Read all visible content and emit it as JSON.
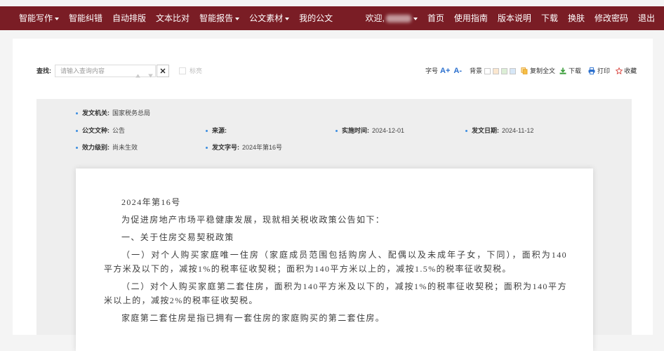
{
  "colors": {
    "nav_background": "#7a1d25",
    "accent_blue": "#2a6fce",
    "bullet_blue": "#3d8ee0",
    "meta_background": "#eeeeee"
  },
  "nav": {
    "left_items": [
      {
        "label": "智能写作",
        "icon": "chevron-down-icon"
      },
      {
        "label": "智能纠错"
      },
      {
        "label": "自动排版"
      },
      {
        "label": "文本比对"
      },
      {
        "label": "智能报告",
        "icon": "chevron-down-icon"
      },
      {
        "label": "公文素材",
        "icon": "chevron-down-icon"
      },
      {
        "label": "我的公文"
      }
    ],
    "user_menu": {
      "welcome": "欢迎,",
      "icon": "chevron-down-icon"
    },
    "right_items": [
      "首页",
      "使用指南",
      "版本说明",
      "下载",
      "换肤",
      "修改密码",
      "退出"
    ]
  },
  "search": {
    "label": "查找:",
    "placeholder": "请输入查询内容",
    "value": "",
    "prev_icon": "arrow-up-icon",
    "next_icon": "arrow-down-icon",
    "clear_icon": "close-icon",
    "highlight_label": "标亮",
    "highlight_checked": false
  },
  "toolbar": {
    "font_size_label": "字号",
    "font_increase": "A+",
    "font_decrease": "A-",
    "background_label": "背景",
    "background_swatches": [
      "#ffffff",
      "#fbe7cf",
      "#dcefd6",
      "#d6e7f7"
    ],
    "copy": {
      "label": "复制全文",
      "icon": "copy-icon"
    },
    "download": {
      "label": "下载",
      "icon": "download-icon"
    },
    "print": {
      "label": "打印",
      "icon": "print-icon"
    },
    "favorite": {
      "label": "收藏",
      "icon": "star-icon"
    }
  },
  "meta": {
    "rows": [
      [
        {
          "label": "发文机关:",
          "value": "国家税务总局"
        }
      ],
      [
        {
          "label": "公文文种:",
          "value": "公告"
        },
        {
          "label": "来源:",
          "value": ""
        },
        {
          "label": "实施时间:",
          "value": "2024-12-01"
        },
        {
          "label": "发文日期:",
          "value": "2024-11-12"
        }
      ],
      [
        {
          "label": "效力级别:",
          "value": "尚未生效"
        },
        {
          "label": "发文字号:",
          "value": "2024年第16号"
        }
      ]
    ]
  },
  "document": {
    "paragraphs": [
      {
        "lines": [
          "2024年第16号"
        ]
      },
      {
        "lines": [
          "为促进房地产市场平稳健康发展，现就相关税收政策公告如下："
        ]
      },
      {
        "lines": [
          "一、关于住房交易契税政策"
        ]
      },
      {
        "lines": [
          "（一）对个人购买家庭唯一住房（家庭成员范围包括购房人、配偶以及未成年子女，下同），面积为140",
          "平方米及以下的，减按1%的税率征收契税；面积为140平方米以上的，减按1.5%的税率征收契税。"
        ]
      },
      {
        "lines": [
          "（二）对个人购买家庭第二套住房，面积为140平方米及以下的，减按1%的税率征收契税；面积为140平方",
          "米以上的，减按2%的税率征收契税。"
        ]
      },
      {
        "lines": [
          "家庭第二套住房是指已拥有一套住房的家庭购买的第二套住房。"
        ]
      }
    ]
  }
}
